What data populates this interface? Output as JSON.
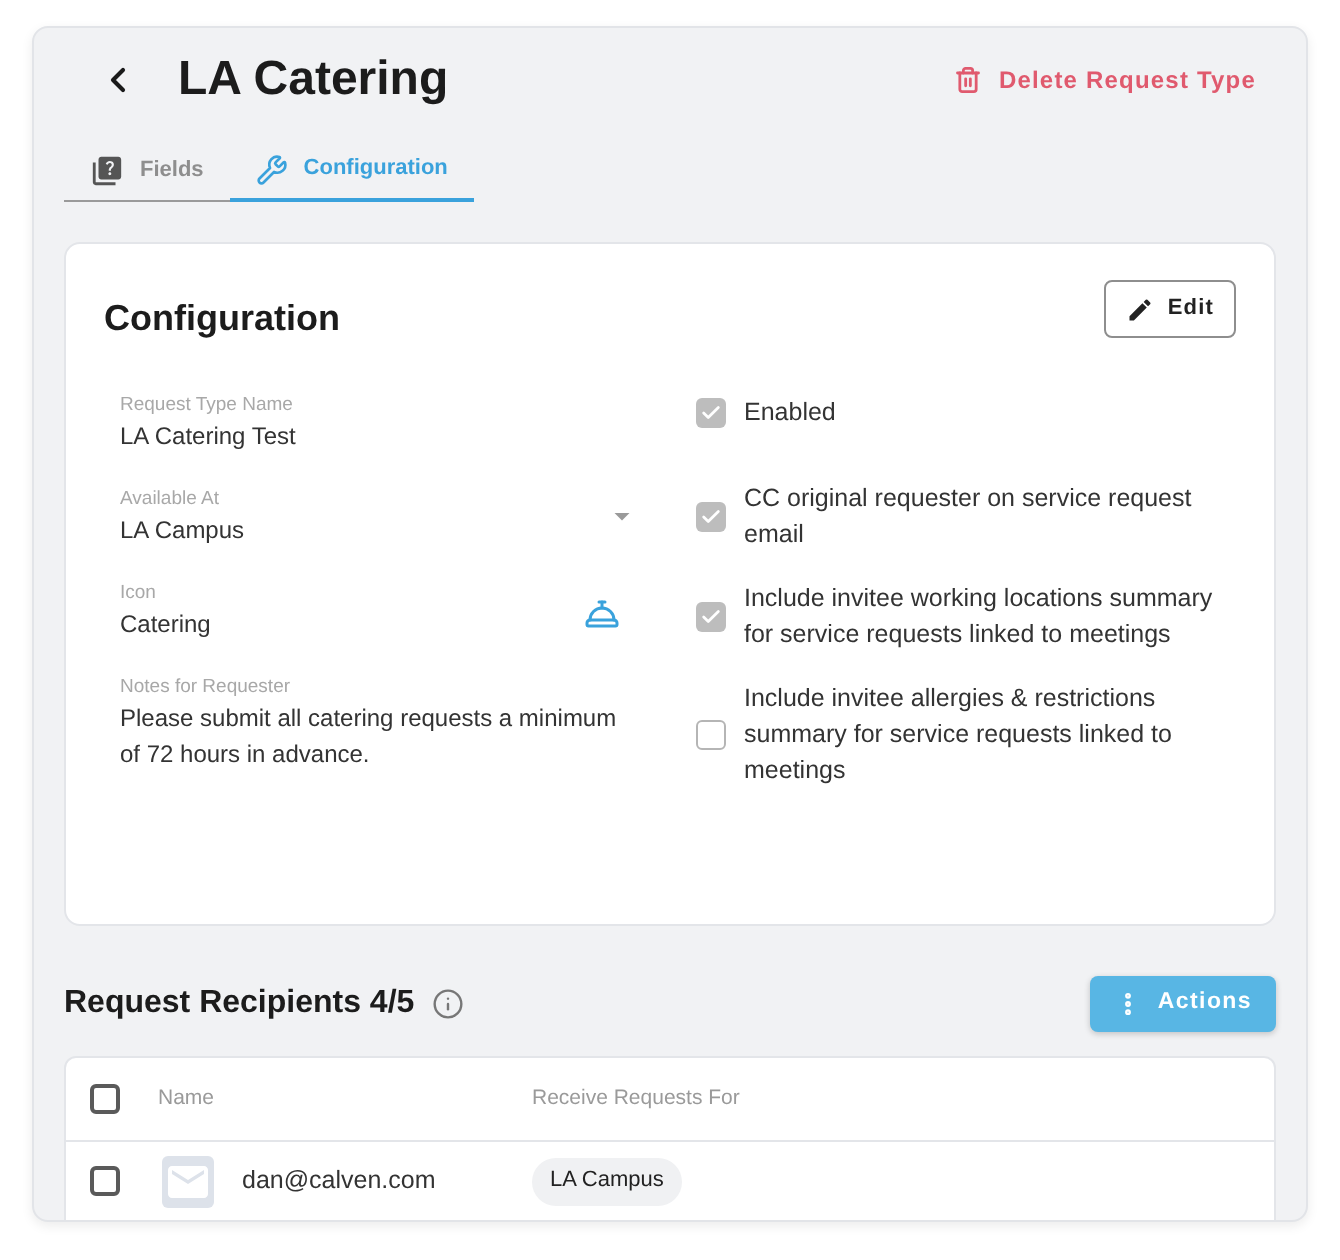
{
  "header": {
    "title": "LA Catering",
    "delete_button": "Delete Request Type"
  },
  "tabs": [
    {
      "label": "Fields",
      "selected": false
    },
    {
      "label": "Configuration",
      "selected": true
    }
  ],
  "configuration": {
    "title": "Configuration",
    "edit_button": "Edit",
    "fields": [
      {
        "kind": "text",
        "label": "Request Type Name",
        "value": "LA Catering Test"
      },
      {
        "kind": "dropdown",
        "label": "Available At",
        "value": "LA Campus"
      },
      {
        "kind": "icon",
        "label": "Icon",
        "value": "Catering"
      },
      {
        "kind": "text",
        "label": "Notes for Requester",
        "value": "Please submit all catering requests a minimum of 72 hours in advance."
      }
    ],
    "options": [
      {
        "label": "Enabled",
        "checked": true
      },
      {
        "label": "CC original requester on service request email",
        "checked": true
      },
      {
        "label": "Include invitee working locations summary for service requests linked to meetings",
        "checked": true
      },
      {
        "label": "Include invitee allergies & restrictions summary for service requests linked to meetings",
        "checked": false
      }
    ]
  },
  "recipients": {
    "title": "Request Recipients 4/5",
    "actions_button": "Actions",
    "columns": [
      "Name",
      "Receive Requests For"
    ],
    "header_checked": false,
    "rows": [
      {
        "checked": false,
        "name": "dan@calven.com",
        "locations": [
          "LA Campus"
        ]
      }
    ]
  }
}
